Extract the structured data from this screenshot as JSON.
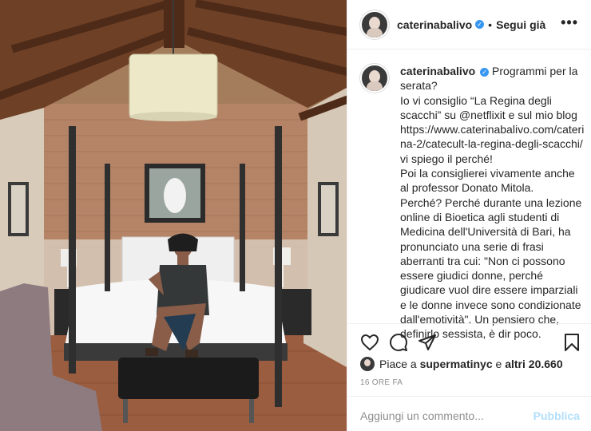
{
  "post": {
    "username": "caterinabalivo",
    "follow_separator": "•",
    "follow_label": "Segui già",
    "more_label": "•••",
    "caption": "Programmi per la serata?\nIo vi consiglio “La Regina degli scacchi” su @netflixit e sul mio blog https://www.caterinabalivo.com/caterina-2/catecult-la-regina-degli-scacchi/ vi spiego il perché!\nPoi la consiglierei vivamente anche al professor Donato Mitola.\nPerché? Perché durante una lezione online di Bioetica agli studenti di Medicina dell'Università di Bari, ha pronunciato una serie di frasi aberranti tra cui: \"Non ci possono essere giudici donne, perché giudicare vuol dire essere imparziali e le donne invece sono condizionate dall'emotività\". Un pensiero che, definirlo sessista, è dir poco.",
    "likes_prefix": "Piace a ",
    "likes_user": "supermatinyc",
    "likes_middle": " e ",
    "likes_count": "altri 20.660",
    "timestamp": "16 ORE FA",
    "comment_placeholder": "Aggiungi un commento...",
    "publish_label": "Pubblica"
  },
  "icons": {
    "like": "heart-icon",
    "comment": "comment-icon",
    "share": "paper-plane-icon",
    "save": "bookmark-icon",
    "verified": "verified-badge-icon"
  },
  "colors": {
    "verified_blue": "#3897f0",
    "publish_disabled": "#b2dffc",
    "muted_text": "#8e8e8e"
  }
}
